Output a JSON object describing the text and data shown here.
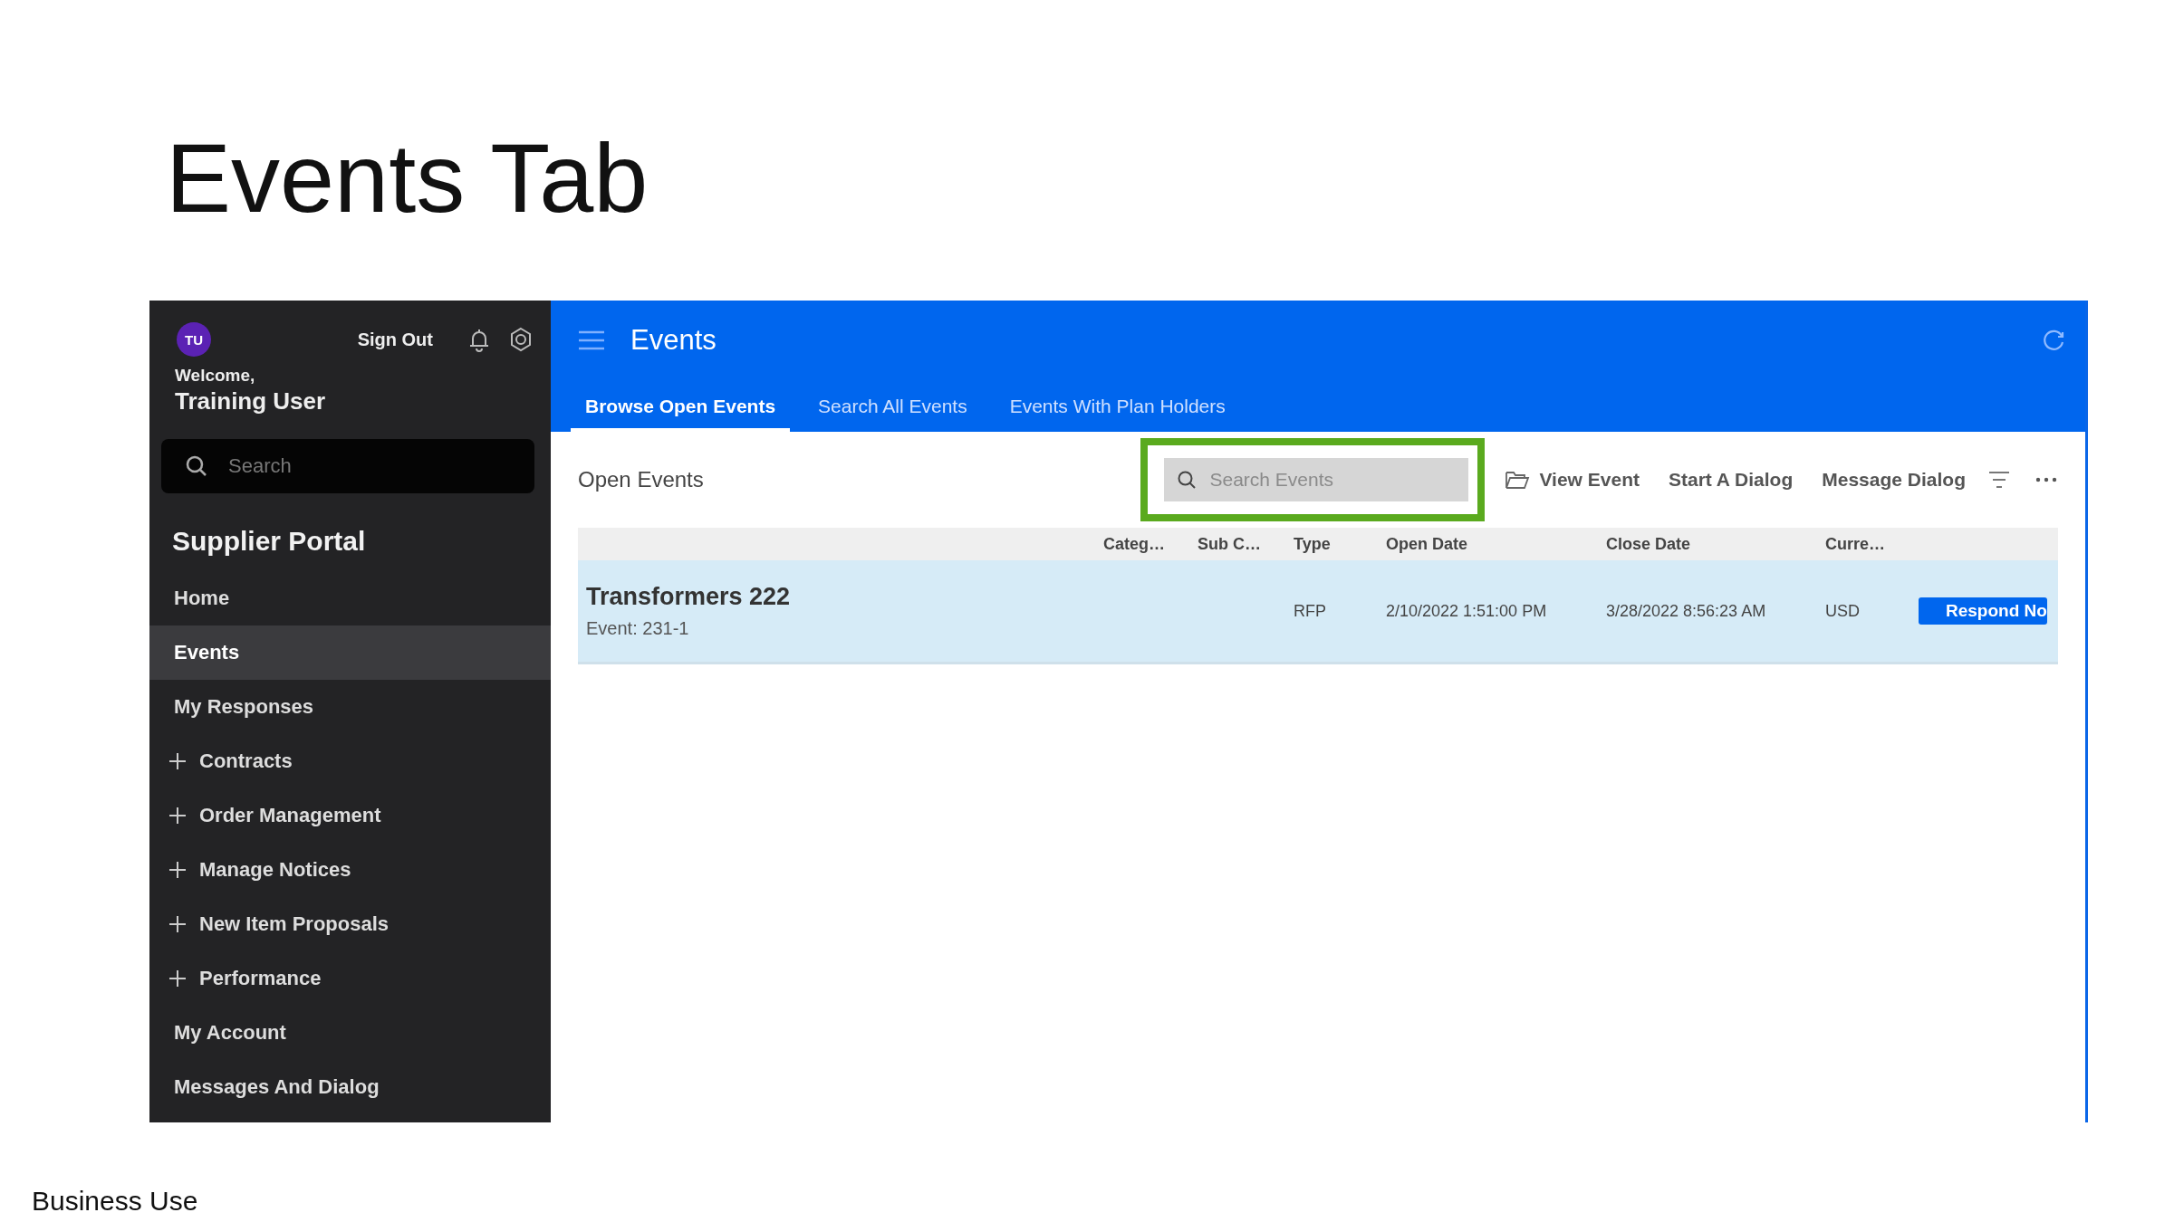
{
  "slide": {
    "title": "Events Tab",
    "footer": "Business Use"
  },
  "sidebar": {
    "avatar": "TU",
    "sign_out": "Sign Out",
    "welcome": "Welcome,",
    "user": "Training User",
    "search": {
      "placeholder": "Search"
    },
    "section": "Supplier Portal",
    "items": [
      {
        "label": "Home",
        "kind": "link",
        "selected": false
      },
      {
        "label": "Events",
        "kind": "link",
        "selected": true
      },
      {
        "label": "My Responses",
        "kind": "link",
        "selected": false
      },
      {
        "label": "Contracts",
        "kind": "group",
        "expanded": false,
        "selected": false
      },
      {
        "label": "Order Management",
        "kind": "group",
        "expanded": false,
        "selected": false
      },
      {
        "label": "Manage Notices",
        "kind": "group",
        "expanded": false,
        "selected": false
      },
      {
        "label": "New Item Proposals",
        "kind": "group",
        "expanded": false,
        "selected": false
      },
      {
        "label": "Performance",
        "kind": "group",
        "expanded": false,
        "selected": false
      },
      {
        "label": "My Account",
        "kind": "link",
        "selected": false
      },
      {
        "label": "Messages And Dialog",
        "kind": "link",
        "selected": false
      }
    ]
  },
  "header": {
    "title": "Events",
    "tabs": [
      {
        "label": "Browse Open Events",
        "selected": true
      },
      {
        "label": "Search All Events",
        "selected": false
      },
      {
        "label": "Events With Plan Holders",
        "selected": false
      }
    ]
  },
  "content": {
    "heading": "Open Events",
    "search": {
      "placeholder": "Search Events",
      "highlighted": true
    },
    "actions": [
      "View Event",
      "Start A Dialog",
      "Message Dialog"
    ],
    "table": {
      "columns": [
        "Categ…",
        "Sub C…",
        "Type",
        "Open Date",
        "Close Date",
        "Curre…"
      ],
      "rows": [
        {
          "title": "Transformers 222",
          "event": "Event: 231-1",
          "type": "RFP",
          "open_date": "2/10/2022 1:51:00 PM",
          "close_date": "3/28/2022 8:56:23 AM",
          "currency": "USD",
          "action": "Respond No",
          "selected": true
        }
      ]
    }
  }
}
